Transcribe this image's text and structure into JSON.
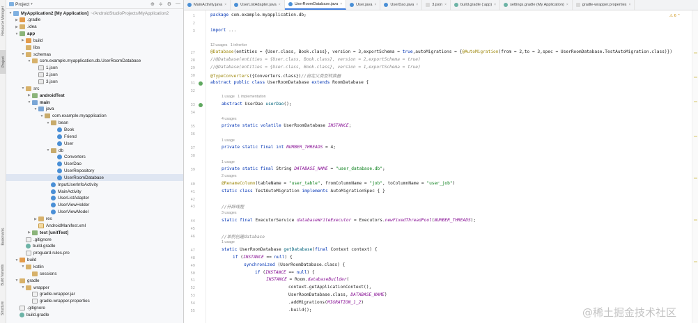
{
  "left_strip": {
    "tabs": [
      "Resource Manager",
      "Project",
      "Bookmarks",
      "Build Variants",
      "Structure"
    ]
  },
  "panel": {
    "title": "Project",
    "tools": [
      "⊕",
      "≑",
      "⚙",
      "—"
    ]
  },
  "tree": [
    {
      "label": "MyApplication2 [My Application]",
      "suffix": "~/AndroidStudioProjects/MyApplication2",
      "icon": "module",
      "indent": 0,
      "expanded": true,
      "bold": true
    },
    {
      "label": ".gradle",
      "icon": "folder-orange",
      "indent": 1,
      "expanded": false
    },
    {
      "label": ".idea",
      "icon": "folder",
      "indent": 1,
      "expanded": false
    },
    {
      "label": "app",
      "icon": "folder-green",
      "indent": 1,
      "expanded": true,
      "bold": true
    },
    {
      "label": "build",
      "icon": "folder-orange",
      "indent": 2,
      "expanded": false
    },
    {
      "label": "libs",
      "icon": "folder",
      "indent": 2,
      "noarrow": true
    },
    {
      "label": "schemas",
      "icon": "folder",
      "indent": 2,
      "expanded": true
    },
    {
      "label": "com.example.myapplication.db.UserRoomDatabase",
      "icon": "folder",
      "indent": 3,
      "expanded": true
    },
    {
      "label": "1.json",
      "icon": "json",
      "indent": 4,
      "noarrow": true
    },
    {
      "label": "2.json",
      "icon": "json",
      "indent": 4,
      "noarrow": true
    },
    {
      "label": "3.json",
      "icon": "json",
      "indent": 4,
      "noarrow": true
    },
    {
      "label": "src",
      "icon": "folder",
      "indent": 2,
      "expanded": true
    },
    {
      "label": "androidTest",
      "icon": "folder-green",
      "indent": 3,
      "expanded": false,
      "bold": true
    },
    {
      "label": "main",
      "icon": "folder-blue",
      "indent": 3,
      "expanded": true,
      "bold": true
    },
    {
      "label": "java",
      "icon": "folder-blue",
      "indent": 4,
      "expanded": true
    },
    {
      "label": "com.example.myapplication",
      "icon": "pkg",
      "indent": 5,
      "expanded": true
    },
    {
      "label": "bean",
      "icon": "pkg",
      "indent": 6,
      "expanded": true
    },
    {
      "label": "Book",
      "icon": "class",
      "indent": 7,
      "noarrow": true
    },
    {
      "label": "Friend",
      "icon": "class",
      "indent": 7,
      "noarrow": true
    },
    {
      "label": "User",
      "icon": "class",
      "indent": 7,
      "noarrow": true
    },
    {
      "label": "db",
      "icon": "pkg",
      "indent": 6,
      "expanded": true
    },
    {
      "label": "Converters",
      "icon": "class",
      "indent": 7,
      "noarrow": true
    },
    {
      "label": "UserDao",
      "icon": "class",
      "indent": 7,
      "noarrow": true
    },
    {
      "label": "UserRepository",
      "icon": "class",
      "indent": 7,
      "noarrow": true
    },
    {
      "label": "UserRoomDatabase",
      "icon": "class",
      "indent": 7,
      "noarrow": true,
      "selected": true
    },
    {
      "label": "InputUserInfoActivity",
      "icon": "class",
      "indent": 6,
      "noarrow": true
    },
    {
      "label": "MainActivity",
      "icon": "class",
      "indent": 6,
      "noarrow": true
    },
    {
      "label": "UserListAdapter",
      "icon": "class",
      "indent": 6,
      "noarrow": true
    },
    {
      "label": "UserViewHolder",
      "icon": "class",
      "indent": 6,
      "noarrow": true
    },
    {
      "label": "UserViewModel",
      "icon": "class",
      "indent": 6,
      "noarrow": true
    },
    {
      "label": "res",
      "icon": "folder",
      "indent": 4,
      "expanded": false
    },
    {
      "label": "AndroidManifest.xml",
      "icon": "xml",
      "indent": 4,
      "noarrow": true
    },
    {
      "label": "test [unitTest]",
      "icon": "folder-green",
      "indent": 3,
      "expanded": false,
      "bold": true
    },
    {
      "label": ".gitignore",
      "icon": "file",
      "indent": 2,
      "noarrow": true
    },
    {
      "label": "build.gradle",
      "icon": "gradle",
      "indent": 2,
      "noarrow": true
    },
    {
      "label": "proguard-rules.pro",
      "icon": "file",
      "indent": 2,
      "noarrow": true
    },
    {
      "label": "build",
      "icon": "folder-orange",
      "indent": 1,
      "expanded": true
    },
    {
      "label": "kotlin",
      "icon": "folder",
      "indent": 2,
      "expanded": true
    },
    {
      "label": "sessions",
      "icon": "folder",
      "indent": 3,
      "noarrow": true
    },
    {
      "label": "gradle",
      "icon": "folder",
      "indent": 1,
      "expanded": true
    },
    {
      "label": "wrapper",
      "icon": "folder",
      "indent": 2,
      "expanded": true
    },
    {
      "label": "gradle-wrapper.jar",
      "icon": "file",
      "indent": 3,
      "noarrow": true
    },
    {
      "label": "gradle-wrapper.properties",
      "icon": "file",
      "indent": 3,
      "noarrow": true
    },
    {
      "label": ".gitignore",
      "icon": "file",
      "indent": 1,
      "noarrow": true
    },
    {
      "label": "build.gradle",
      "icon": "gradle",
      "indent": 1,
      "noarrow": true
    }
  ],
  "tabs": [
    {
      "label": "MainActivity.java",
      "icon": "class"
    },
    {
      "label": "UserListAdapter.java",
      "icon": "class"
    },
    {
      "label": "UserRoomDatabase.java",
      "icon": "class",
      "active": true
    },
    {
      "label": "User.java",
      "icon": "class"
    },
    {
      "label": "UserDao.java",
      "icon": "class"
    },
    {
      "label": "3.json",
      "icon": "json"
    },
    {
      "label": "build.gradle (:app)",
      "icon": "gradle"
    },
    {
      "label": "settings.gradle (My Application)",
      "icon": "gradle"
    },
    {
      "label": "gradle-wrapper.properties",
      "icon": "json"
    }
  ],
  "warning_badge": "⚠ 6  ⌃",
  "code_lines": [
    {
      "n": "1",
      "t": "code",
      "s": [
        [
          "kw",
          "package "
        ],
        [
          "",
          "com.example.myapplication.db;"
        ]
      ]
    },
    {
      "n": "2",
      "t": "code",
      "s": []
    },
    {
      "n": "3",
      "t": "code",
      "s": [
        [
          "kw",
          "import "
        ],
        [
          "",
          "..."
        ]
      ]
    },
    {
      "n": "",
      "t": "code",
      "s": []
    },
    {
      "n": "",
      "t": "hint",
      "s": [
        [
          "",
          "12 usages   1 inheritor"
        ]
      ]
    },
    {
      "n": "27",
      "t": "code",
      "s": [
        [
          "an",
          "@Database"
        ],
        [
          "",
          "(entities = {User.class, Book.class}, version = 3,exportSchema = "
        ],
        [
          "kw",
          "true"
        ],
        [
          "",
          ",autoMigrations = {"
        ],
        [
          "an",
          "@AutoMigration"
        ],
        [
          "",
          "(from = 2,to = 3,spec = UserRoomDatabase.TestAutoMigration.class)})"
        ]
      ]
    },
    {
      "n": "28",
      "t": "code",
      "s": [
        [
          "cm",
          "//@Database(entities = {User.class, Book.class}, version = 2,exportSchema = true)"
        ]
      ]
    },
    {
      "n": "29",
      "t": "code",
      "s": [
        [
          "cm",
          "//@Database(entities = {User.class, Book.class}, version = 1,exportSchema = true)"
        ]
      ]
    },
    {
      "n": "30",
      "t": "code",
      "s": [
        [
          "an",
          "@TypeConverters"
        ],
        [
          "",
          "({Converters.class})"
        ],
        [
          "cm",
          "//自定义类型转换器"
        ]
      ]
    },
    {
      "n": "31",
      "t": "code",
      "mark": true,
      "s": [
        [
          "kw",
          "abstract public class "
        ],
        [
          "",
          "UserRoomDatabase "
        ],
        [
          "kw",
          "extends "
        ],
        [
          "",
          "RoomDatabase {"
        ]
      ]
    },
    {
      "n": "32",
      "t": "code",
      "s": []
    },
    {
      "n": "",
      "t": "hint",
      "indent": 1,
      "s": [
        [
          "",
          "1 usage   1 implementation"
        ]
      ]
    },
    {
      "n": "33",
      "t": "code",
      "mark": true,
      "indent": 1,
      "s": [
        [
          "kw",
          "abstract "
        ],
        [
          "",
          "UserDao "
        ],
        [
          "fn",
          "userDao"
        ],
        [
          "",
          "();"
        ]
      ]
    },
    {
      "n": "34",
      "t": "code",
      "s": []
    },
    {
      "n": "",
      "t": "hint",
      "indent": 1,
      "s": [
        [
          "",
          "4 usages"
        ]
      ]
    },
    {
      "n": "35",
      "t": "code",
      "indent": 1,
      "s": [
        [
          "kw",
          "private static volatile "
        ],
        [
          "",
          "UserRoomDatabase "
        ],
        [
          "it",
          "INSTANCE"
        ],
        [
          "",
          ";"
        ]
      ]
    },
    {
      "n": "36",
      "t": "code",
      "s": []
    },
    {
      "n": "",
      "t": "hint",
      "indent": 1,
      "s": [
        [
          "",
          "1 usage"
        ]
      ]
    },
    {
      "n": "37",
      "t": "code",
      "indent": 1,
      "s": [
        [
          "kw",
          "private static final int "
        ],
        [
          "it",
          "NUMBER_THREADS"
        ],
        [
          "",
          " = 4;"
        ]
      ]
    },
    {
      "n": "38",
      "t": "code",
      "s": []
    },
    {
      "n": "",
      "t": "hint",
      "indent": 1,
      "s": [
        [
          "",
          "1 usage"
        ]
      ]
    },
    {
      "n": "39",
      "t": "code",
      "indent": 1,
      "s": [
        [
          "kw",
          "private static final "
        ],
        [
          "",
          "String "
        ],
        [
          "it",
          "DATABASE_NAME"
        ],
        [
          "",
          " = "
        ],
        [
          "st",
          "\"user_database.db\""
        ],
        [
          "",
          ";"
        ]
      ]
    },
    {
      "n": "",
      "t": "hint",
      "indent": 1,
      "s": [
        [
          "",
          "2 usages"
        ]
      ]
    },
    {
      "n": "40",
      "t": "code",
      "indent": 1,
      "s": [
        [
          "an",
          "@RenameColumn"
        ],
        [
          "",
          "(tableName = "
        ],
        [
          "st",
          "\"user_table\""
        ],
        [
          "",
          ", fromColumnName = "
        ],
        [
          "st",
          "\"job\""
        ],
        [
          "",
          ", toColumnName = "
        ],
        [
          "st",
          "\"user_job\""
        ],
        [
          "",
          ")"
        ]
      ]
    },
    {
      "n": "41",
      "t": "code",
      "indent": 1,
      "s": [
        [
          "kw",
          "static class "
        ],
        [
          "",
          "TestAutoMigration "
        ],
        [
          "kw",
          "implements "
        ],
        [
          "",
          "AutoMigrationSpec { }"
        ]
      ]
    },
    {
      "n": "42",
      "t": "code",
      "s": []
    },
    {
      "n": "43",
      "t": "code",
      "indent": 1,
      "s": [
        [
          "cm",
          "//开辟线程"
        ]
      ]
    },
    {
      "n": "",
      "t": "hint",
      "indent": 1,
      "s": [
        [
          "",
          "3 usages"
        ]
      ]
    },
    {
      "n": "44",
      "t": "code",
      "indent": 1,
      "s": [
        [
          "kw",
          "static final "
        ],
        [
          "",
          "ExecutorService "
        ],
        [
          "it",
          "databaseWriteExecutor"
        ],
        [
          "",
          " = Executors."
        ],
        [
          "it",
          "newFixedThreadPool"
        ],
        [
          "",
          "("
        ],
        [
          "it",
          "NUMBER_THREADS"
        ],
        [
          "",
          ");"
        ]
      ]
    },
    {
      "n": "45",
      "t": "code",
      "s": []
    },
    {
      "n": "46",
      "t": "code",
      "indent": 1,
      "s": [
        [
          "cm",
          "//单例创建database"
        ]
      ]
    },
    {
      "n": "",
      "t": "hint",
      "indent": 1,
      "s": [
        [
          "",
          "1 usage"
        ]
      ]
    },
    {
      "n": "47",
      "t": "code",
      "indent": 1,
      "s": [
        [
          "kw",
          "static "
        ],
        [
          "",
          "UserRoomDatabase "
        ],
        [
          "fn",
          "getDatabase"
        ],
        [
          "",
          "("
        ],
        [
          "kw",
          "final "
        ],
        [
          "",
          "Context context) {"
        ]
      ]
    },
    {
      "n": "48",
      "t": "code",
      "indent": 2,
      "s": [
        [
          "kw",
          "if "
        ],
        [
          "",
          "("
        ],
        [
          "it",
          "INSTANCE"
        ],
        [
          "",
          " == "
        ],
        [
          "kw",
          "null"
        ],
        [
          "",
          ") {"
        ]
      ]
    },
    {
      "n": "49",
      "t": "code",
      "indent": 3,
      "s": [
        [
          "kw",
          "synchronized "
        ],
        [
          "",
          "(UserRoomDatabase.class) {"
        ]
      ]
    },
    {
      "n": "50",
      "t": "code",
      "indent": 4,
      "s": [
        [
          "kw",
          "if "
        ],
        [
          "",
          "("
        ],
        [
          "it",
          "INSTANCE"
        ],
        [
          "",
          " == "
        ],
        [
          "kw",
          "null"
        ],
        [
          "",
          ") {"
        ]
      ]
    },
    {
      "n": "51",
      "t": "code",
      "indent": 5,
      "s": [
        [
          "it",
          "INSTANCE"
        ],
        [
          "",
          " = Room."
        ],
        [
          "it",
          "databaseBuilder"
        ],
        [
          "",
          "("
        ]
      ]
    },
    {
      "n": "52",
      "t": "code",
      "indent": 7,
      "s": [
        [
          "",
          "context.getApplicationContext(),"
        ]
      ]
    },
    {
      "n": "53",
      "t": "code",
      "indent": 7,
      "s": [
        [
          "",
          "UserRoomDatabase.class, "
        ],
        [
          "it",
          "DATABASE_NAME"
        ],
        [
          "",
          ")"
        ]
      ]
    },
    {
      "n": "54",
      "t": "code",
      "indent": 7,
      "s": [
        [
          "",
          ".addMigrations("
        ],
        [
          "it",
          "MIGRATION_1_2"
        ],
        [
          "",
          ")"
        ]
      ]
    },
    {
      "n": "55",
      "t": "code",
      "indent": 7,
      "s": [
        [
          "",
          ".build();"
        ]
      ]
    }
  ],
  "watermark": "@稀土掘金技术社区"
}
